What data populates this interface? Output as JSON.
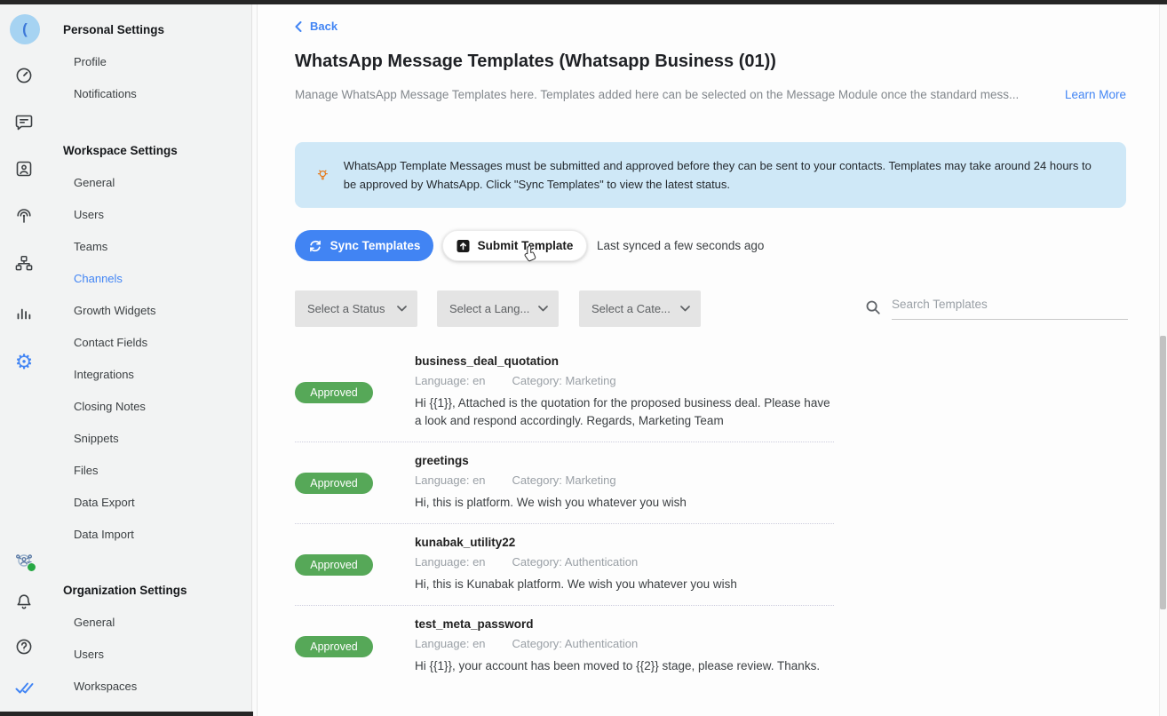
{
  "colors": {
    "accent_blue": "#4285f4",
    "approved_green": "#56a858",
    "banner_blue": "#cfe8f7",
    "bulb_orange": "#e8710a"
  },
  "icons": {
    "avatar_glyph": "(",
    "gear_glyph": "⚙",
    "help_glyph": "?"
  },
  "sidebar": {
    "sections": [
      {
        "title": "Personal Settings",
        "items": [
          "Profile",
          "Notifications"
        ]
      },
      {
        "title": "Workspace Settings",
        "items": [
          "General",
          "Users",
          "Teams",
          "Channels",
          "Growth Widgets",
          "Contact Fields",
          "Integrations",
          "Closing Notes",
          "Snippets",
          "Files",
          "Data Export",
          "Data Import"
        ]
      },
      {
        "title": "Organization Settings",
        "items": [
          "General",
          "Users",
          "Workspaces"
        ]
      }
    ],
    "active_item": "Channels"
  },
  "header": {
    "back_label": "Back",
    "title": "WhatsApp Message Templates (Whatsapp Business (01))",
    "description": "Manage WhatsApp Message Templates here. Templates added here can be selected on the Message Module once the standard mess...",
    "learn_more": "Learn More"
  },
  "banner": {
    "text": "WhatsApp Template Messages must be submitted and approved before they can be sent to your contacts. Templates may take around 24 hours to be approved by WhatsApp. Click \"Sync Templates\" to view the latest status."
  },
  "toolbar": {
    "sync_label": "Sync Templates",
    "submit_label": "Submit Template",
    "last_synced": "Last synced a few seconds ago"
  },
  "filters": {
    "status_placeholder": "Select a Status",
    "language_placeholder": "Select a Lang...",
    "category_placeholder": "Select a Cate...",
    "search_placeholder": "Search Templates"
  },
  "templates": [
    {
      "status": "Approved",
      "name": "business_deal_quotation",
      "language": "Language: en",
      "category": "Category: Marketing",
      "body": "Hi {{1}}, Attached is the quotation for the proposed business deal. Please have a look and respond accordingly. Regards, Marketing Team"
    },
    {
      "status": "Approved",
      "name": "greetings",
      "language": "Language: en",
      "category": "Category: Marketing",
      "body": "Hi, this is platform. We wish you whatever you wish"
    },
    {
      "status": "Approved",
      "name": "kunabak_utility22",
      "language": "Language: en",
      "category": "Category: Authentication",
      "body": "Hi, this is Kunabak platform. We wish you whatever you wish"
    },
    {
      "status": "Approved",
      "name": "test_meta_password",
      "language": "Language: en",
      "category": "Category: Authentication",
      "body": "Hi {{1}}, your account has been moved to {{2}} stage, please review. Thanks."
    }
  ]
}
